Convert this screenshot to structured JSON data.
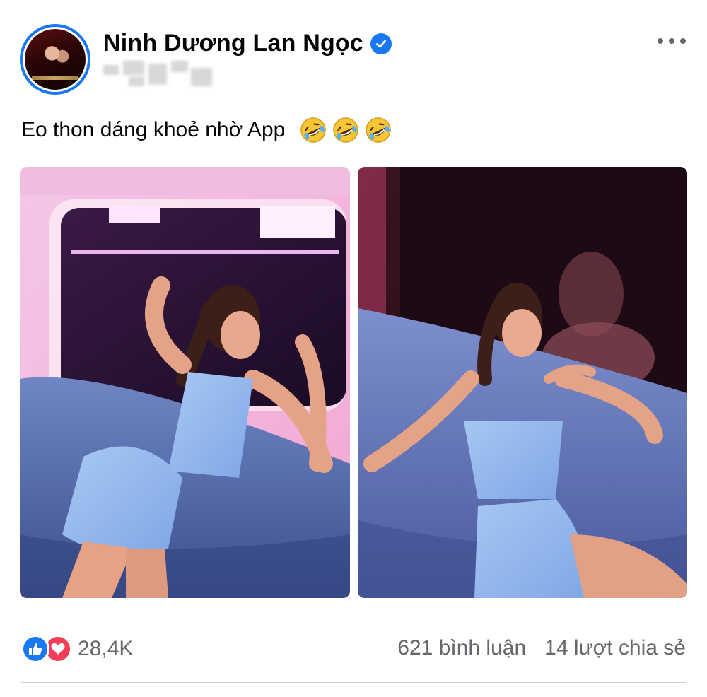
{
  "post": {
    "author": "Ninh Dương Lan Ngọc",
    "verified": true,
    "caption": "Eo thon dáng khoẻ nhờ App",
    "caption_emoji": [
      "rolling-on-floor-laughing",
      "rolling-on-floor-laughing",
      "rolling-on-floor-laughing"
    ],
    "photos": [
      "photo-left",
      "photo-right"
    ]
  },
  "footer": {
    "reaction_count": "28,4K",
    "reactions": [
      "like-icon",
      "love-icon"
    ],
    "comments": "621 bình luận",
    "shares": "14 lượt chia sẻ"
  },
  "colors": {
    "brand_blue": "#1877f2",
    "love_red": "#f33e58",
    "secondary_text": "#65676b"
  }
}
